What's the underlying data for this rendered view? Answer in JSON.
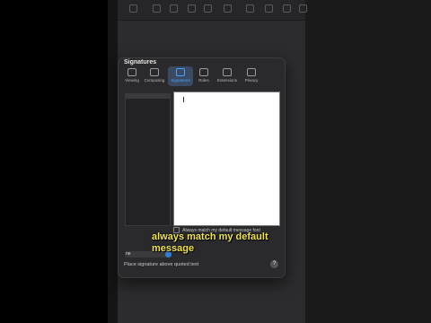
{
  "window": {
    "title": "Signatures"
  },
  "tabs": [
    {
      "label": "Viewing",
      "active": false
    },
    {
      "label": "Composing",
      "active": false
    },
    {
      "label": "Signatures",
      "active": true
    },
    {
      "label": "Rules",
      "active": false
    },
    {
      "label": "Extensions",
      "active": false
    },
    {
      "label": "Privacy",
      "active": false
    }
  ],
  "signature_options": {
    "match_font_label": "Always match my default message font",
    "choose_signature_value": "ne",
    "place_above_label": "Place signature above quoted text",
    "help_label": "?"
  },
  "caption": {
    "line1": "always match my default",
    "line2": "message"
  },
  "colors": {
    "accent": "#4aa3ff",
    "caption": "#f0e44a"
  }
}
